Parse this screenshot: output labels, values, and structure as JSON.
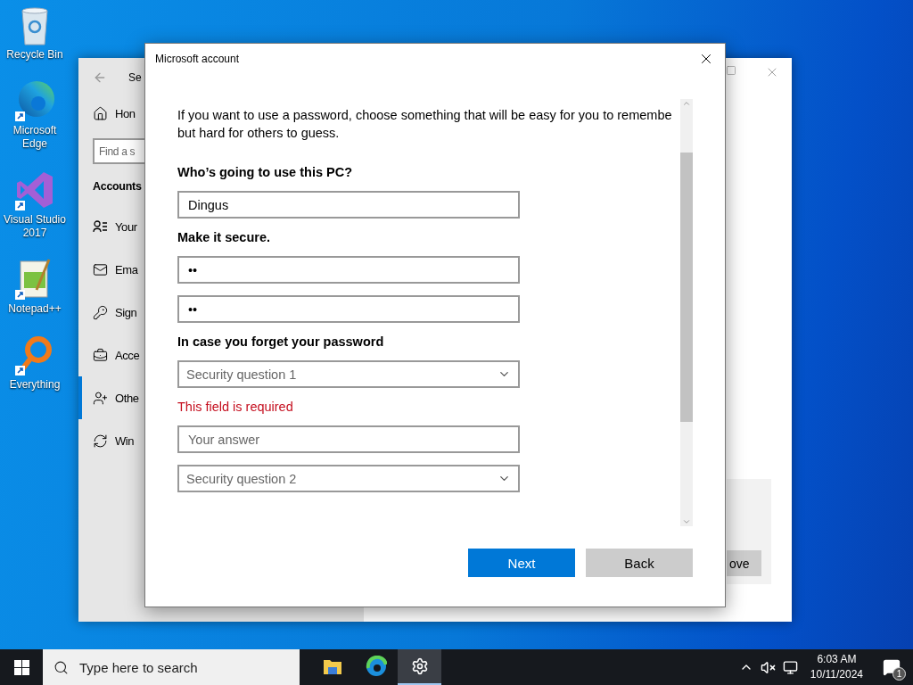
{
  "desktop_icons": [
    {
      "label": "Recycle Bin",
      "kind": "recycle"
    },
    {
      "label": "Microsoft Edge",
      "kind": "edge"
    },
    {
      "label": "Visual Studio 2017",
      "kind": "studio"
    },
    {
      "label": "Notepad++",
      "kind": "notepad"
    },
    {
      "label": "Everything",
      "kind": "magnifier"
    }
  ],
  "settings_window": {
    "title": "Se",
    "home": "Hon",
    "search": {
      "placeholder": "Find a s"
    },
    "section": "Accounts",
    "nav": [
      {
        "label": "Your",
        "kind": "person-list",
        "selected": false
      },
      {
        "label": "Ema",
        "kind": "mail",
        "selected": false
      },
      {
        "label": "Sign",
        "kind": "key",
        "selected": false
      },
      {
        "label": "Acce",
        "kind": "briefcase",
        "selected": false
      },
      {
        "label": "Othe",
        "kind": "person-add",
        "selected": true
      },
      {
        "label": "Win",
        "kind": "sync",
        "selected": false
      }
    ],
    "button": "ove"
  },
  "dialog": {
    "title": "Microsoft account",
    "intro_lines": [
      "If you want to use a password, choose something that will be easy for you to remembe",
      "but hard for others to guess."
    ],
    "form": [
      {
        "kind": "label",
        "text": "Who’s going to use this PC?"
      },
      {
        "kind": "input",
        "value": "Dingus"
      },
      {
        "kind": "label",
        "text": "Make it secure."
      },
      {
        "kind": "input",
        "value": "••"
      },
      {
        "kind": "input",
        "value": "••"
      },
      {
        "kind": "label",
        "text": "In case you forget your password"
      },
      {
        "kind": "select",
        "placeholder": "Security question 1"
      },
      {
        "kind": "error",
        "text": "This field is required"
      },
      {
        "kind": "input",
        "placeholder": "Your answer"
      },
      {
        "kind": "select",
        "placeholder": "Security question 2"
      }
    ],
    "buttons": [
      {
        "label": "Next",
        "kind": "primary"
      },
      {
        "label": "Back",
        "kind": "secondary"
      }
    ]
  },
  "taskbar": {
    "search": {
      "placeholder": "Type here to search"
    },
    "apps": [
      {
        "kind": "explorer",
        "selected": false
      },
      {
        "kind": "edge",
        "selected": false
      },
      {
        "kind": "settings",
        "selected": true
      }
    ],
    "volume_muted": true,
    "time": "6:03 AM",
    "date": "10/11/2024",
    "notifications": "1"
  }
}
